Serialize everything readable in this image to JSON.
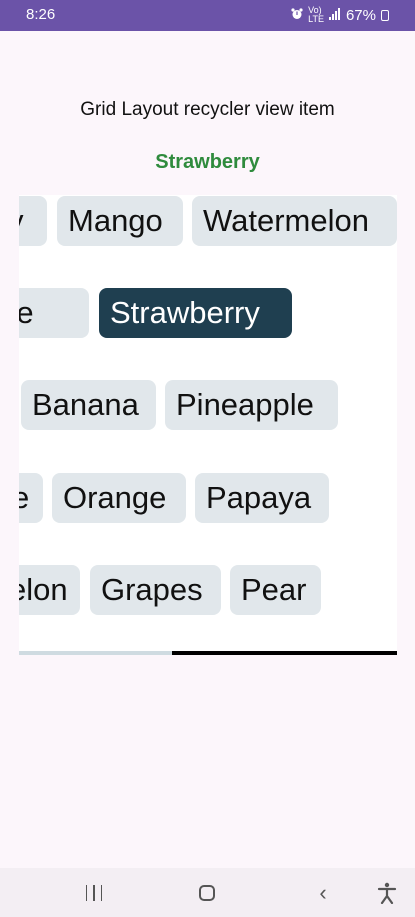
{
  "status_bar": {
    "time": "8:26",
    "net_top": "Vo)",
    "net_bottom": "LTE",
    "battery": "67%",
    "icons": [
      "alarm-icon",
      "volte-icon",
      "signal-icon",
      "battery-icon"
    ]
  },
  "header": {
    "title": "Grid Layout recycler view item",
    "selected_item": "Strawberry"
  },
  "grid": {
    "rows": [
      [
        "y",
        "Mango",
        "Watermelon"
      ],
      [
        "pple",
        "Strawberry"
      ],
      [
        "Banana",
        "Pineapple"
      ],
      [
        "e",
        "Orange",
        "Papaya"
      ],
      [
        "elon",
        "Grapes",
        "Pear"
      ]
    ],
    "selected": "Strawberry",
    "colors": {
      "chip": "#e1e7eb",
      "chip_selected": "#1f3f50",
      "selected_text": "#2f8b3d"
    },
    "scroll_position": 0.6
  },
  "nav_bar": {
    "back_glyph": "‹",
    "accessibility_glyph": "✦",
    "icons": [
      "recents-icon",
      "home-icon",
      "back-icon",
      "accessibility-icon"
    ]
  }
}
